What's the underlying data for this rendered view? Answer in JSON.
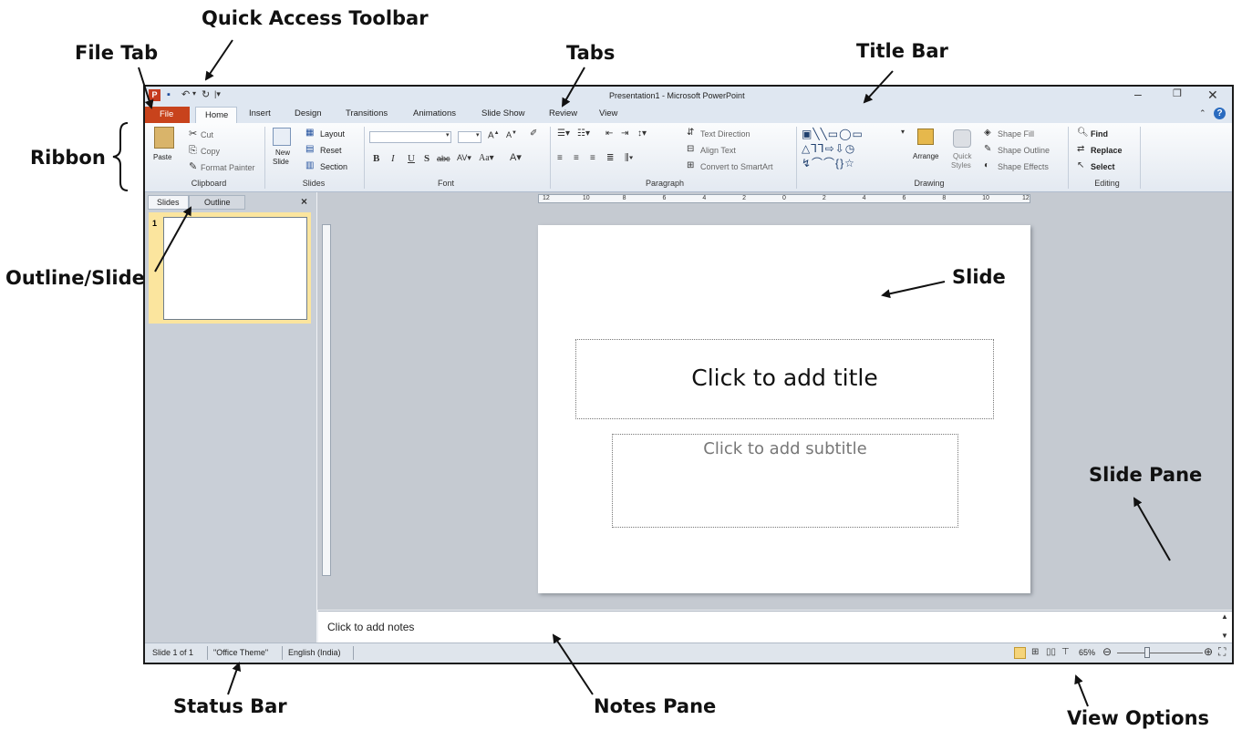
{
  "callouts": {
    "quick_access": "Quick Access Toolbar",
    "file_tab": "File Tab",
    "tabs": "Tabs",
    "title_bar": "Title Bar",
    "ribbon": "Ribbon",
    "outline_slides": "Outline/Slides Tabs",
    "slide": "Slide",
    "slide_pane": "Slide Pane",
    "status_bar": "Status Bar",
    "notes_pane": "Notes Pane",
    "view_options": "View Options"
  },
  "window": {
    "title": "Presentation1 - Microsoft PowerPoint",
    "app_icon": "powerpoint-icon"
  },
  "tabs": [
    "File",
    "Home",
    "Insert",
    "Design",
    "Transitions",
    "Animations",
    "Slide Show",
    "Review",
    "View"
  ],
  "ribbon": {
    "clipboard": {
      "paste": "Paste",
      "cut": "Cut",
      "copy": "Copy",
      "format_painter": "Format Painter",
      "label": "Clipboard"
    },
    "slides": {
      "new_slide_1": "New",
      "new_slide_2": "Slide",
      "layout": "Layout",
      "reset": "Reset",
      "section": "Section",
      "label": "Slides"
    },
    "font": {
      "label": "Font"
    },
    "paragraph": {
      "text_direction": "Text Direction",
      "align_text": "Align Text",
      "convert": "Convert to SmartArt",
      "label": "Paragraph"
    },
    "drawing": {
      "arrange": "Arrange",
      "quick_styles_1": "Quick",
      "quick_styles_2": "Styles",
      "shape_fill": "Shape Fill",
      "shape_outline": "Shape Outline",
      "shape_effects": "Shape Effects",
      "label": "Drawing"
    },
    "editing": {
      "find": "Find",
      "replace": "Replace",
      "select": "Select",
      "label": "Editing"
    }
  },
  "left_panel": {
    "slides_tab": "Slides",
    "outline_tab": "Outline",
    "close": "×",
    "thumb_number": "1"
  },
  "slide": {
    "title_placeholder": "Click to add title",
    "subtitle_placeholder": "Click to add subtitle"
  },
  "notes": {
    "placeholder": "Click to add notes"
  },
  "status": {
    "slide_count": "Slide 1 of 1",
    "theme": "\"Office Theme\"",
    "language": "English (India)",
    "zoom": "65%"
  },
  "ruler_labels": [
    "12",
    "10",
    "8",
    "6",
    "4",
    "2",
    "0",
    "2",
    "4",
    "6",
    "8",
    "10",
    "12"
  ]
}
